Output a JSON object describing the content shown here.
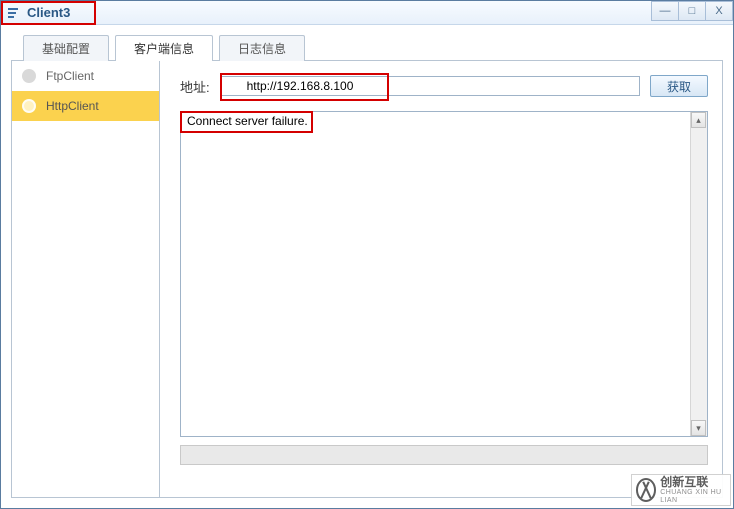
{
  "window": {
    "title": "Client3",
    "controls": {
      "minimize": "—",
      "maximize": "□",
      "close": "X"
    }
  },
  "tabs": [
    {
      "label": "基础配置",
      "active": false
    },
    {
      "label": "客户端信息",
      "active": true
    },
    {
      "label": "日志信息",
      "active": false
    }
  ],
  "sidebar": {
    "items": [
      {
        "label": "FtpClient",
        "selected": false
      },
      {
        "label": "HttpClient",
        "selected": true
      }
    ]
  },
  "main": {
    "address_label": "地址:",
    "address_value": "http://192.168.8.100",
    "get_button": "获取",
    "output": "Connect server failure."
  },
  "watermark": {
    "cn": "创新互联",
    "en": "CHUANG XIN HU LIAN"
  }
}
